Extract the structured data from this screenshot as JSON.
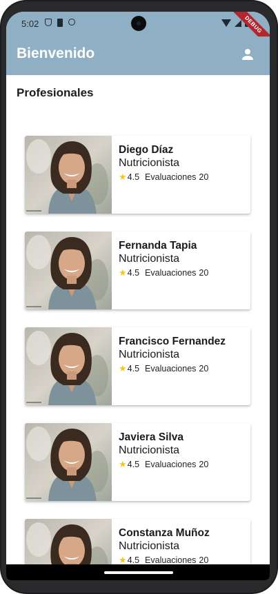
{
  "status": {
    "time": "5:02"
  },
  "debug_banner": "DEBUG",
  "appbar": {
    "title": "Bienvenido"
  },
  "section": {
    "title": "Profesionales"
  },
  "professionals": [
    {
      "name": "Diego Díaz",
      "role": "Nutricionista",
      "rating": "4.5",
      "eval_label": "Evaluaciones",
      "eval_count": "20"
    },
    {
      "name": "Fernanda Tapia",
      "role": "Nutricionista",
      "rating": "4.5",
      "eval_label": "Evaluaciones",
      "eval_count": "20"
    },
    {
      "name": "Francisco Fernandez",
      "role": "Nutricionista",
      "rating": "4.5",
      "eval_label": "Evaluaciones",
      "eval_count": "20"
    },
    {
      "name": "Javiera Silva",
      "role": "Nutricionista",
      "rating": "4.5",
      "eval_label": "Evaluaciones",
      "eval_count": "20"
    },
    {
      "name": "Constanza Muñoz",
      "role": "Nutricionista",
      "rating": "4.5",
      "eval_label": "Evaluaciones",
      "eval_count": "20"
    }
  ],
  "icons": {
    "profile": "person-icon",
    "rating": "star-icon",
    "photo": "woman-portrait-photo"
  },
  "colors": {
    "appbar": "#8eafc4",
    "star": "#f5c518",
    "debug": "#b3262d"
  }
}
